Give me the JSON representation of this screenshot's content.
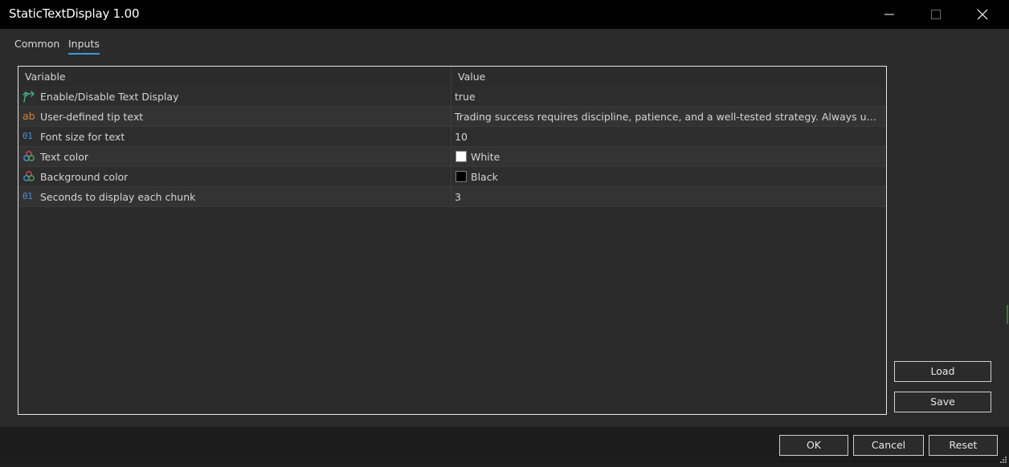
{
  "window": {
    "title": "StaticTextDisplay 1.00",
    "controls": [
      "minimize-icon",
      "maximize-icon",
      "close-icon"
    ]
  },
  "tabs": [
    {
      "label": "Common",
      "active": false
    },
    {
      "label": "Inputs",
      "active": true
    }
  ],
  "table": {
    "columns": [
      "Variable",
      "Value"
    ],
    "rows": [
      {
        "icon": "boolean-arrow-icon",
        "variable": "Enable/Disable Text Display",
        "value": "true"
      },
      {
        "icon": "ab-string-icon",
        "variable": "User-defined tip text",
        "value": "Trading success requires discipline, patience, and a well-tested strategy. Always use prop..."
      },
      {
        "icon": "number-01-icon",
        "variable": "Font size for text",
        "value": "10"
      },
      {
        "icon": "color-circles-icon",
        "variable": "Text color",
        "value": "White",
        "swatch": "#ffffff"
      },
      {
        "icon": "color-circles-icon",
        "variable": "Background color",
        "value": "Black",
        "swatch": "#000000"
      },
      {
        "icon": "number-01-icon",
        "variable": "Seconds to display each chunk",
        "value": "3"
      }
    ]
  },
  "side_buttons": {
    "load": "Load",
    "save": "Save"
  },
  "footer_buttons": {
    "ok": "OK",
    "cancel": "Cancel",
    "reset": "Reset"
  },
  "colors": {
    "accent": "#3a9ad9",
    "background": "#2b2b2b",
    "titlebar": "#000000"
  }
}
